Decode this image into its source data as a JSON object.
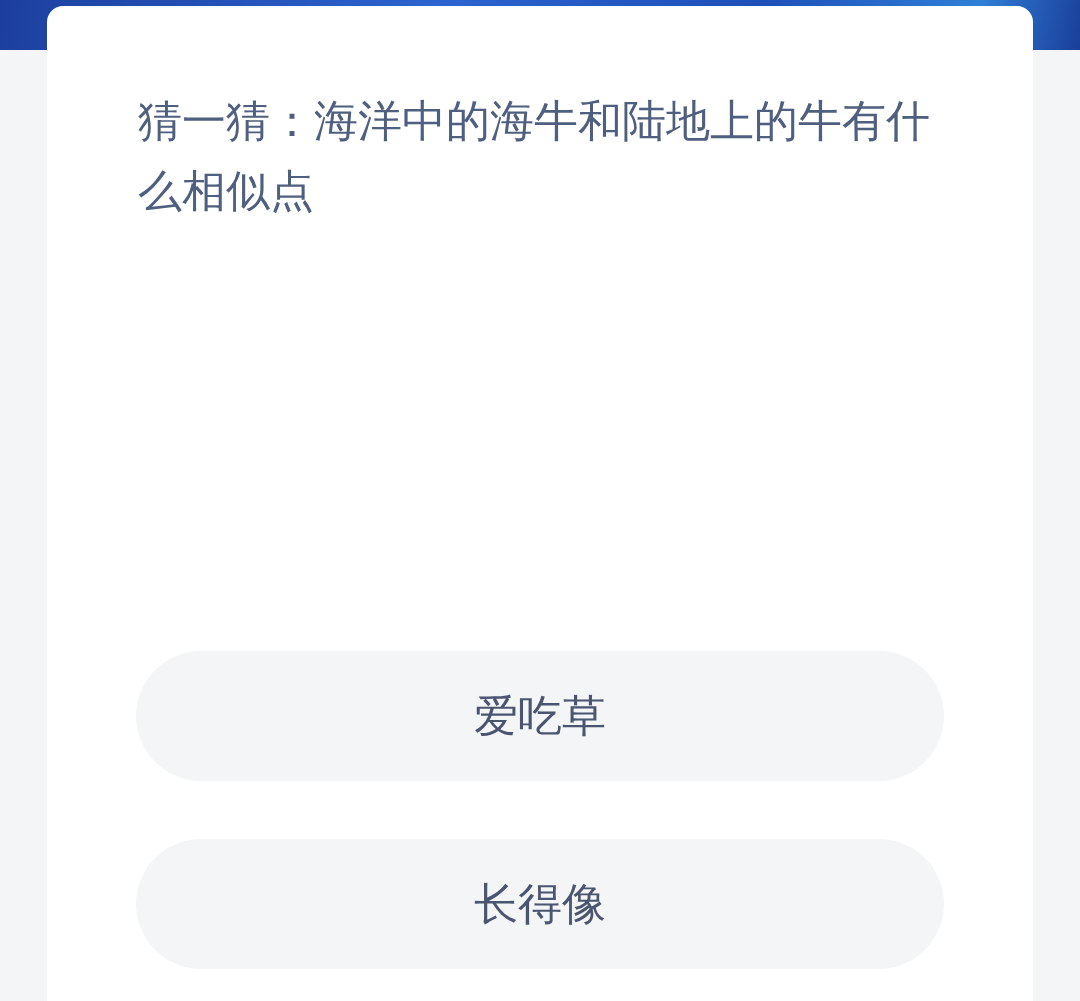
{
  "question": "猜一猜：海洋中的海牛和陆地上的牛有什么相似点",
  "options": [
    {
      "label": "爱吃草"
    },
    {
      "label": "长得像"
    }
  ]
}
